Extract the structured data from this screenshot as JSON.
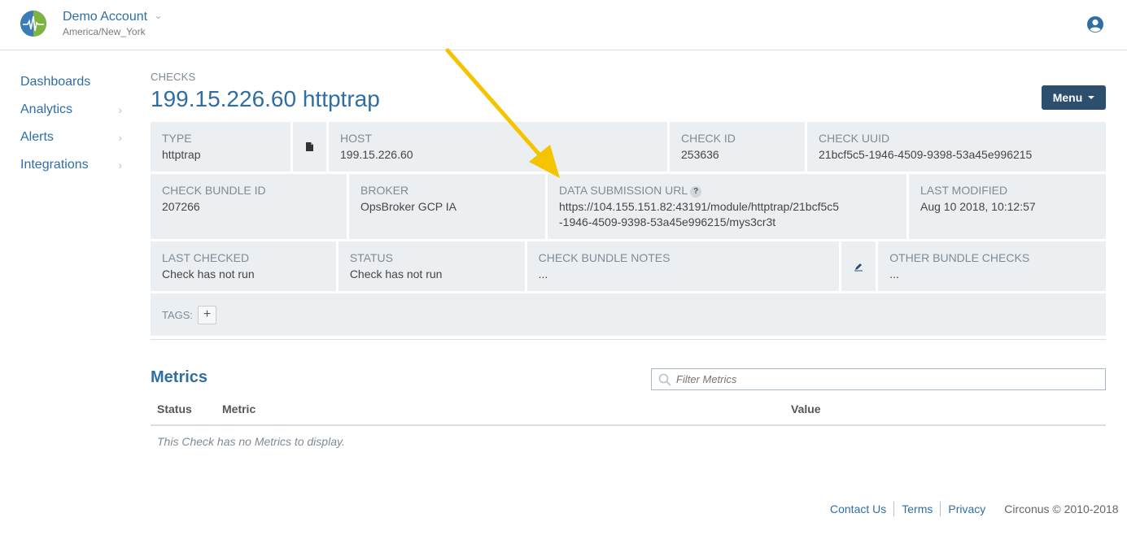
{
  "account": {
    "name": "Demo Account",
    "timezone": "America/New_York"
  },
  "sidebar": {
    "items": [
      {
        "label": "Dashboards",
        "has_submenu": false
      },
      {
        "label": "Analytics",
        "has_submenu": true
      },
      {
        "label": "Alerts",
        "has_submenu": true
      },
      {
        "label": "Integrations",
        "has_submenu": true
      }
    ]
  },
  "page": {
    "breadcrumb": "CHECKS",
    "title": "199.15.226.60 httptrap",
    "menu_label": "Menu"
  },
  "details": {
    "type": {
      "label": "TYPE",
      "value": "httptrap"
    },
    "host": {
      "label": "HOST",
      "value": "199.15.226.60"
    },
    "check_id": {
      "label": "CHECK ID",
      "value": "253636"
    },
    "check_uuid": {
      "label": "CHECK UUID",
      "value": "21bcf5c5-1946-4509-9398-53a45e996215"
    },
    "bundle_id": {
      "label": "CHECK BUNDLE ID",
      "value": "207266"
    },
    "broker": {
      "label": "BROKER",
      "value": "OpsBroker GCP IA"
    },
    "submission_url": {
      "label": "DATA SUBMISSION URL",
      "help": "?",
      "value_line1": "https://104.155.151.82:43191/module/httptrap/21bcf5c5",
      "value_line2": "-1946-4509-9398-53a45e996215/mys3cr3t"
    },
    "last_modified": {
      "label": "LAST MODIFIED",
      "value": "Aug 10 2018, 10:12:57"
    },
    "last_checked": {
      "label": "LAST CHECKED",
      "value": "Check has not run"
    },
    "status": {
      "label": "STATUS",
      "value": "Check has not run"
    },
    "bundle_notes": {
      "label": "CHECK BUNDLE NOTES",
      "value": "..."
    },
    "other_checks": {
      "label": "OTHER BUNDLE CHECKS",
      "value": "..."
    },
    "tags": {
      "label": "TAGS:",
      "add": "+"
    }
  },
  "metrics": {
    "title": "Metrics",
    "filter_placeholder": "Filter Metrics",
    "columns": [
      "Status",
      "Metric",
      "Value"
    ],
    "empty_message": "This Check has no Metrics to display."
  },
  "footer": {
    "links": [
      "Contact Us",
      "Terms",
      "Privacy"
    ],
    "copyright": "Circonus © 2010-2018"
  },
  "annotation": {
    "color": "#f5c400"
  },
  "icons": {
    "logo": "circonus-logo-icon",
    "user": "user-circle-icon",
    "type_doc": "document-icon",
    "edit": "pencil-icon",
    "search": "search-icon",
    "chevron": "chevron-right-icon"
  }
}
